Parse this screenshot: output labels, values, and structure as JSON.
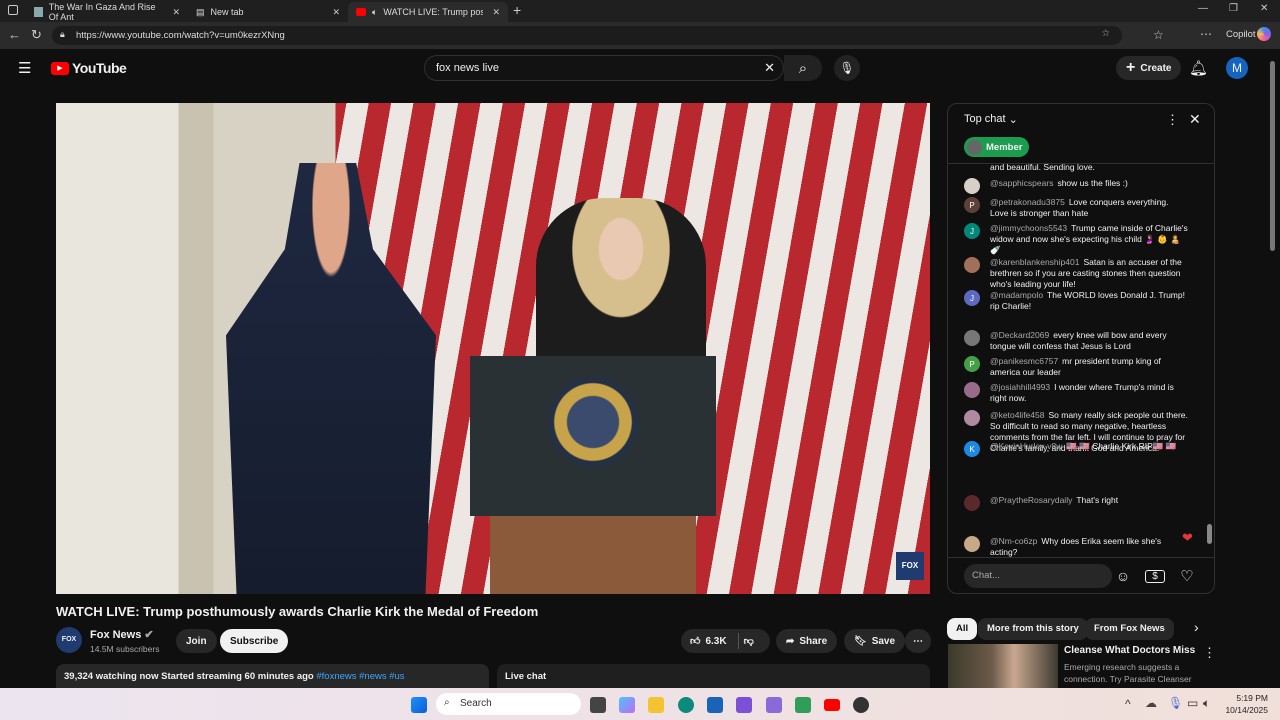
{
  "browser": {
    "tabs": [
      {
        "title": "The War In Gaza And Rise Of Ant"
      },
      {
        "title": "New tab"
      },
      {
        "title": "WATCH LIVE: Trump posthum"
      }
    ],
    "url": "https://www.youtube.com/watch?v=um0kezrXNng",
    "copilot": "Copilot"
  },
  "youtube": {
    "logo": "YouTube",
    "search_value": "fox news live",
    "create": "Create",
    "avatar": "M"
  },
  "video": {
    "title": "WATCH LIVE: Trump posthumously awards Charlie Kirk the Medal of Freedom",
    "bug": "FOX NEWS"
  },
  "channel": {
    "name": "Fox News",
    "subscribers": "14.5M subscribers",
    "join": "Join",
    "subscribe": "Subscribe",
    "likes": "6.3K",
    "share": "Share",
    "save": "Save"
  },
  "info": {
    "stats": "39,324 watching now  Started streaming 60 minutes ago",
    "tags": "#foxnews #news #us",
    "live_chat": "Live chat"
  },
  "chat": {
    "header": "Top chat",
    "member": "Member",
    "placeholder": "Chat...",
    "partial": "and beautiful. Sending love.",
    "messages": [
      {
        "author": "@sapphicspears",
        "text": "show us the files :)",
        "initial": "",
        "color": "#d8d0c8"
      },
      {
        "author": "@petrakonadu3875",
        "text": "Love conquers everything. Love is stronger than hate",
        "initial": "P",
        "color": "#5d4037"
      },
      {
        "author": "@jimmychoons5543",
        "text": "Trump came inside of Charlie's widow and now she's expecting his child 🤰 👶 🧑‍🍼 🍼",
        "initial": "J",
        "color": "#00897b"
      },
      {
        "author": "@karenblankenship401",
        "text": "Satan is an accuser of the brethren so if you are casting stones then question who's leading your life!",
        "initial": "",
        "color": "#a0705a"
      },
      {
        "author": "@madampolo",
        "text": "The WORLD loves Donald J. Trump! rip Charlie!",
        "initial": "J",
        "color": "#5c6bc0"
      },
      {
        "author": "@Deckard2069",
        "text": "every knee will bow and every tongue will confess that Jesus is Lord",
        "initial": "",
        "color": "#777"
      },
      {
        "author": "@panikesmc6757",
        "text": "mr president trump king of america our leader",
        "initial": "P",
        "color": "#43a047"
      },
      {
        "author": "@josiahhill4993",
        "text": "I wonder where Trump's mind is right now.",
        "initial": "",
        "color": "#9a6a8a"
      },
      {
        "author": "@keto4life458",
        "text": "So many really sick people out there. So difficult to read so many negative, heartless comments from the far left. I will continue to pray for Charlie's family, and thank God and America.",
        "initial": "",
        "color": "#b08aa0"
      },
      {
        "author": "@KevinHurley-v8w",
        "text": "🇺🇸 🇺🇸 Charlie Kirk RIP🇺🇸 🇺🇸",
        "initial": "K",
        "color": "#1e88e5"
      },
      {
        "author": "@PraytheRosarydaily",
        "text": "That's right",
        "initial": "",
        "color": "#5a2a2a"
      },
      {
        "author": "@Nm-co6zp",
        "text": "Why does Erika seem like she's acting?",
        "initial": "",
        "color": "#c8a888"
      }
    ]
  },
  "related": {
    "chips": [
      "All",
      "More from this story",
      "From Fox News"
    ],
    "item": {
      "title": "Cleanse What Doctors Miss",
      "desc": "Emerging research suggests a connection. Try Parasite Cleanser"
    }
  },
  "taskbar": {
    "search": "Search",
    "time": "5:19 PM",
    "date": "10/14/2025"
  }
}
